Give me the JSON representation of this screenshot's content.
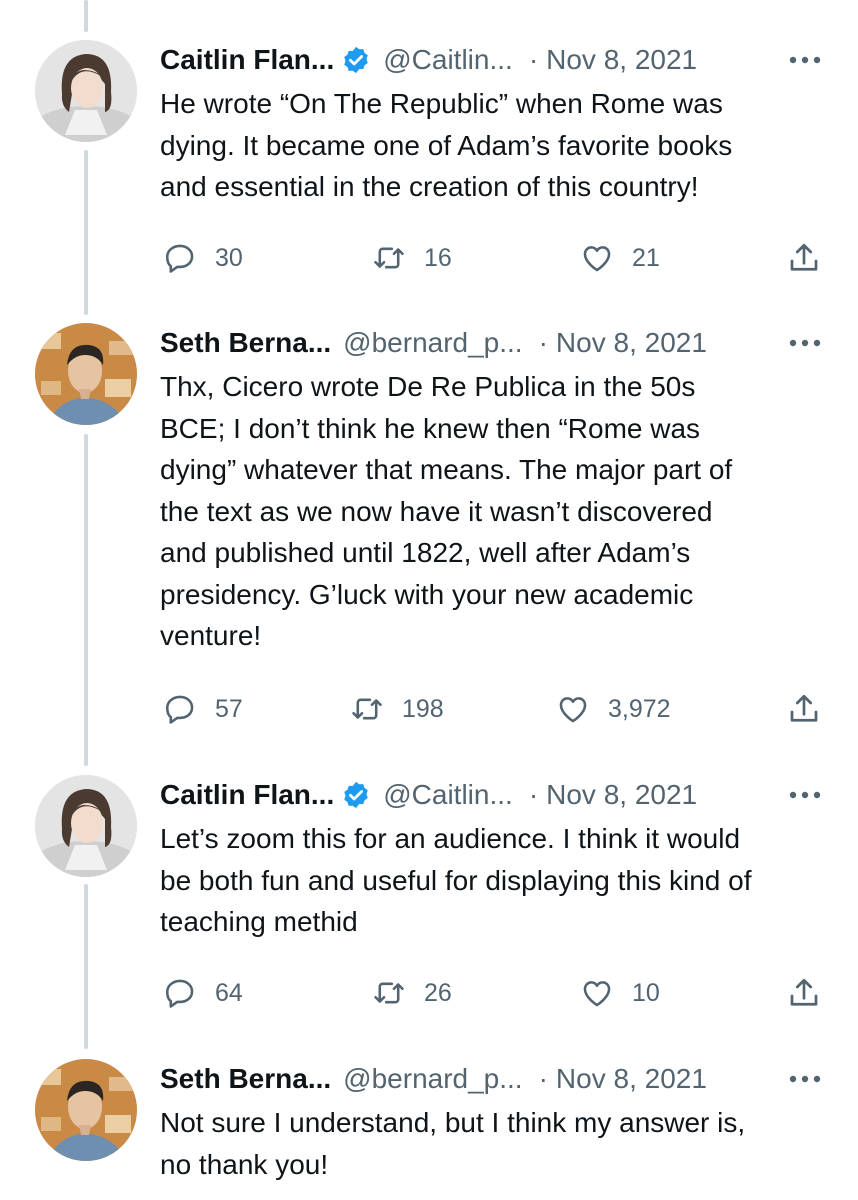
{
  "tweets": [
    {
      "name": "Caitlin Flan...",
      "verified": true,
      "handle": "@Caitlin...",
      "separator": "·",
      "date": "Nov 8, 2021",
      "text": "He wrote “On The Republic” when Rome was\ndying. It became one of Adam’s favorite books\nand essential in the creation of this country!",
      "replies": "30",
      "retweets": "16",
      "likes": "21"
    },
    {
      "name": "Seth Berna...",
      "verified": false,
      "handle": "@bernard_p...",
      "separator": "·",
      "date": "Nov 8, 2021",
      "text": "Thx, Cicero wrote De Re Publica in the 50s\nBCE; I don’t think he knew then “Rome was\ndying” whatever that means. The major part of\nthe text as we now have it wasn’t discovered\nand published until 1822, well after Adam’s\npresidency. G’luck with your new academic\nventure!",
      "replies": "57",
      "retweets": "198",
      "likes": "3,972"
    },
    {
      "name": "Caitlin Flan...",
      "verified": true,
      "handle": "@Caitlin...",
      "separator": "·",
      "date": "Nov 8, 2021",
      "text": "Let’s zoom this for an audience. I think it would\nbe both fun and useful for displaying this kind of\nteaching methid",
      "replies": "64",
      "retweets": "26",
      "likes": "10"
    },
    {
      "name": "Seth Berna...",
      "verified": false,
      "handle": "@bernard_p...",
      "separator": "·",
      "date": "Nov 8, 2021",
      "text": "Not sure I understand, but I think my answer is,\nno thank you!"
    }
  ],
  "icons": {
    "reply": "reply-icon",
    "retweet": "retweet-icon",
    "like": "heart-icon",
    "share": "share-icon",
    "more": "more-icon",
    "verified": "verified-badge-icon"
  },
  "colors": {
    "verified_blue": "#1d9bf0",
    "secondary_text": "#536471",
    "thread_line": "#cfd9de"
  }
}
